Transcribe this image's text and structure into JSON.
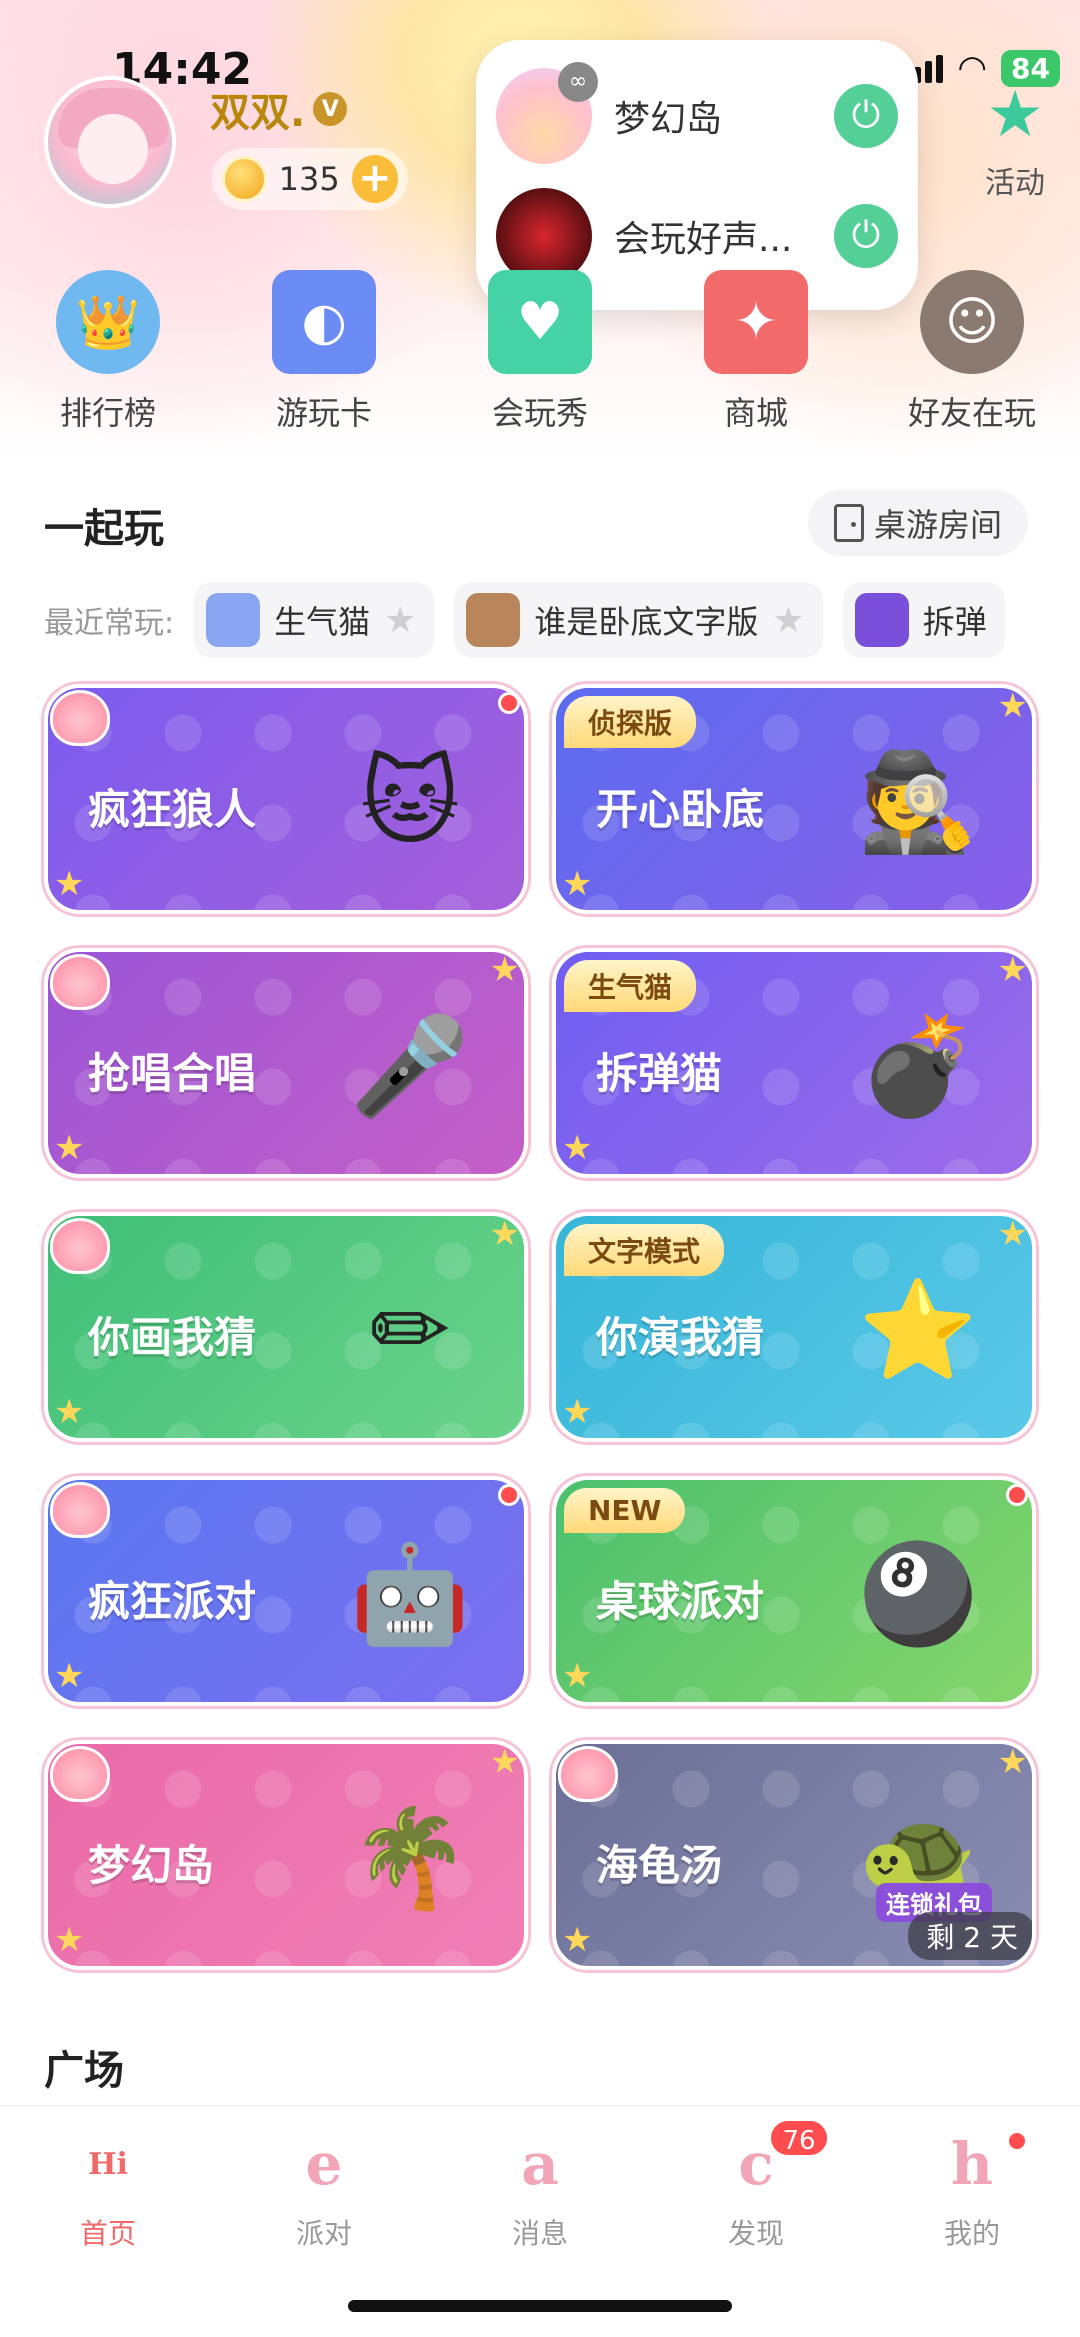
{
  "status": {
    "time": "14:42",
    "battery": "84"
  },
  "profile": {
    "name": "双双.",
    "verified": "V",
    "coins": "135"
  },
  "activity": {
    "label": "活动"
  },
  "popup": [
    {
      "title": "梦幻岛"
    },
    {
      "title": "会玩好声..."
    }
  ],
  "quicknav": [
    {
      "label": "排行榜",
      "icon": "crown-avatar-icon",
      "color": "#6fb8f0"
    },
    {
      "label": "游玩卡",
      "icon": "card-icon",
      "color": "#6b8cf5"
    },
    {
      "label": "会玩秀",
      "icon": "shirt-icon",
      "color": "#45d3a6"
    },
    {
      "label": "商城",
      "icon": "shop-icon",
      "color": "#f36a6a"
    },
    {
      "label": "好友在玩",
      "icon": "friend-avatar-icon",
      "color": "#8a7a70"
    }
  ],
  "section_play": {
    "title": "一起玩",
    "room_button": "桌游房间"
  },
  "recent": {
    "label": "最近常玩:",
    "items": [
      {
        "name": "生气猫"
      },
      {
        "name": "谁是卧底文字版"
      },
      {
        "name": "拆弹"
      }
    ]
  },
  "games": [
    {
      "title": "疯狂狼人",
      "tag": "",
      "color_class": "c-purple",
      "art": "🐱"
    },
    {
      "title": "开心卧底",
      "tag": "侦探版",
      "color_class": "c-indigo",
      "art": "🕵"
    },
    {
      "title": "抢唱合唱",
      "tag": "",
      "color_class": "c-violet",
      "art": "🎤"
    },
    {
      "title": "拆弹猫",
      "tag": "生气猫",
      "color_class": "c-grape",
      "art": "💣"
    },
    {
      "title": "你画我猜",
      "tag": "",
      "color_class": "c-green",
      "art": "✏"
    },
    {
      "title": "你演我猜",
      "tag": "文字模式",
      "color_class": "c-cyan",
      "art": "⭐"
    },
    {
      "title": "疯狂派对",
      "tag": "",
      "color_class": "c-blue",
      "art": "🤖"
    },
    {
      "title": "桌球派对",
      "tag": "NEW",
      "color_class": "c-lime",
      "art": "🎱"
    },
    {
      "title": "梦幻岛",
      "tag": "",
      "color_class": "c-pink",
      "art": "🌴"
    },
    {
      "title": "海龟汤",
      "tag": "",
      "color_class": "c-slate",
      "art": "🐢"
    }
  ],
  "gift": {
    "label": "连锁礼包",
    "remaining": "剩 2 天"
  },
  "section_square": {
    "title": "广场"
  },
  "tabs": [
    {
      "label": "首页",
      "glyph": "Hi",
      "active": true
    },
    {
      "label": "派对",
      "glyph": "e"
    },
    {
      "label": "消息",
      "glyph": "a"
    },
    {
      "label": "发现",
      "glyph": "c",
      "badge": "76"
    },
    {
      "label": "我的",
      "glyph": "h"
    }
  ]
}
